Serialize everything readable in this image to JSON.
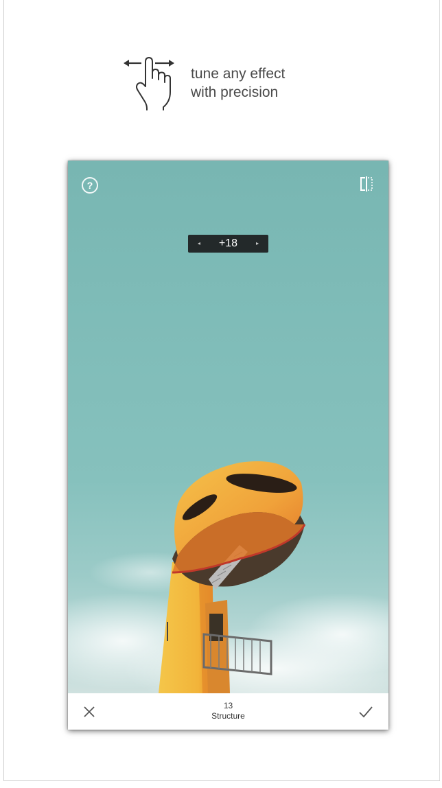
{
  "hint": {
    "icon": "swipe-left-right-hand-icon",
    "line1": "tune any effect",
    "line2": "with precision"
  },
  "editor": {
    "help_icon": "question-circle-icon",
    "help_glyph": "?",
    "compare_icon": "compare-split-icon",
    "adjustment": {
      "value": "+18",
      "left_arrow": "◂",
      "right_arrow": "▸"
    },
    "bottom_bar": {
      "cancel_icon": "close-icon",
      "apply_icon": "checkmark-icon",
      "tool_value": "13",
      "tool_name": "Structure"
    }
  },
  "colors": {
    "sky": "#7fbcb8",
    "pill": "#23292a",
    "tower_yellow": "#f2b43a",
    "tower_orange": "#e88a2a"
  }
}
